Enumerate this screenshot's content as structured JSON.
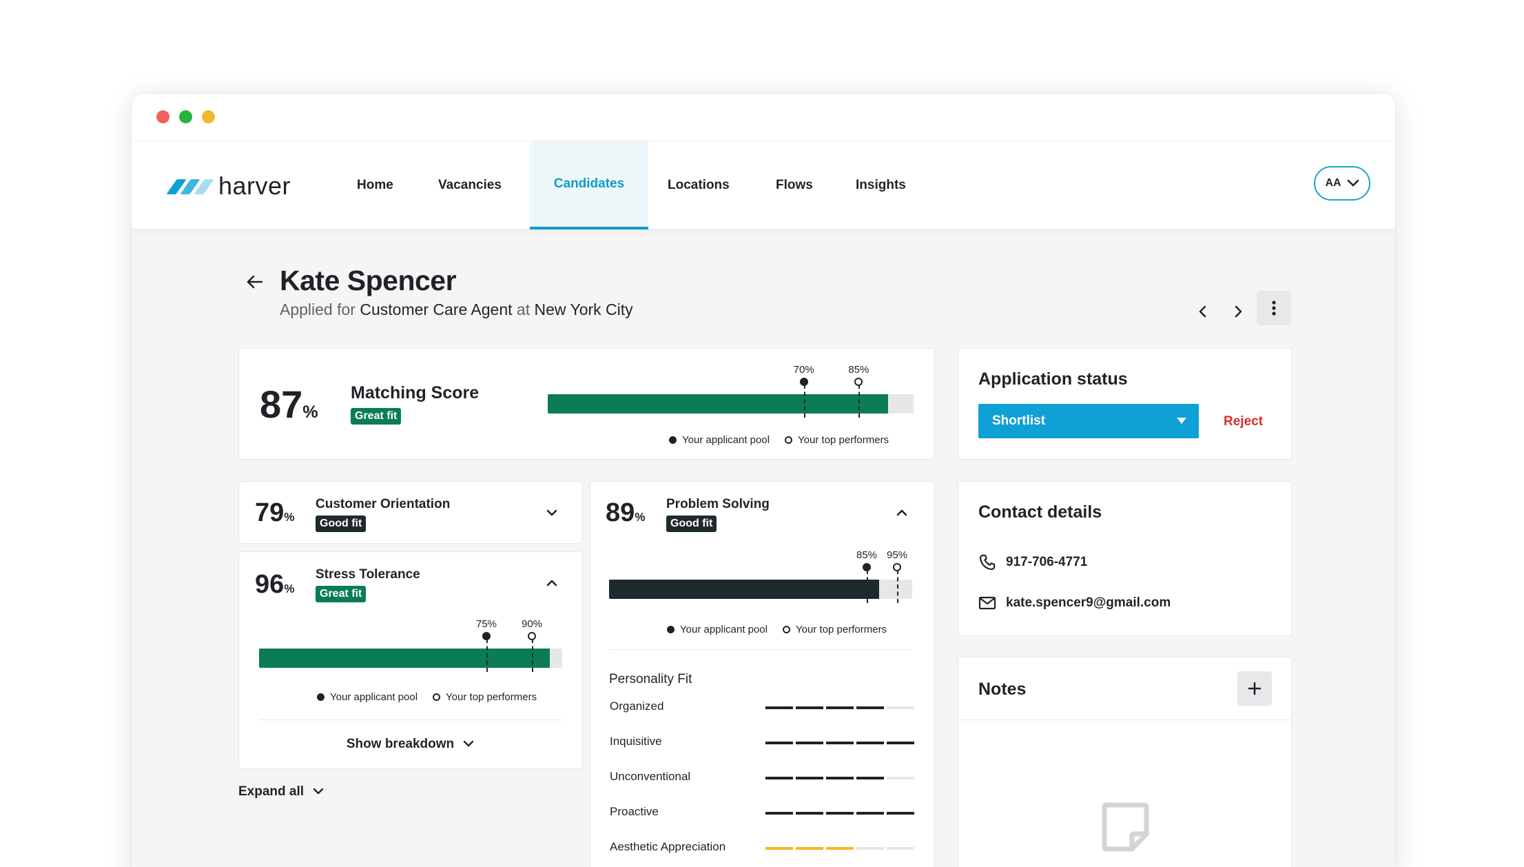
{
  "window": {
    "controls": [
      "close",
      "minimize",
      "maximize"
    ]
  },
  "nav": {
    "brand": "harver",
    "items": [
      {
        "label": "Home"
      },
      {
        "label": "Vacancies"
      },
      {
        "label": "Candidates",
        "active": true
      },
      {
        "label": "Locations"
      },
      {
        "label": "Flows"
      },
      {
        "label": "Insights"
      }
    ],
    "user_initials": "AA"
  },
  "candidate": {
    "name": "Kate Spencer",
    "applied_prefix": "Applied for",
    "role": "Customer Care Agent",
    "at_word": "at",
    "location": "New York City"
  },
  "matching": {
    "score": "87",
    "pct_sign": "%",
    "title": "Matching Score",
    "badge": "Great fit",
    "pool_pct": "70%",
    "top_pct": "85%",
    "pool_value": 70,
    "top_value": 85,
    "fill_value": 93,
    "legend_pool": "Your applicant pool",
    "legend_top": "Your top performers"
  },
  "competencies": {
    "customer_orientation": {
      "score": "79",
      "title": "Customer Orientation",
      "badge": "Good fit"
    },
    "stress_tolerance": {
      "score": "96",
      "title": "Stress Tolerance",
      "badge": "Great fit",
      "pool_pct": "75%",
      "top_pct": "90%",
      "pool_value": 75,
      "top_value": 90,
      "fill_value": 96,
      "legend_pool": "Your applicant pool",
      "legend_top": "Your top performers",
      "show_breakdown": "Show breakdown"
    },
    "problem_solving": {
      "score": "89",
      "title": "Problem Solving",
      "badge": "Good fit",
      "pool_pct": "85%",
      "top_pct": "95%",
      "pool_value": 85,
      "top_value": 95,
      "fill_value": 89,
      "legend_pool": "Your applicant pool",
      "legend_top": "Your top performers"
    },
    "expand_all": "Expand all"
  },
  "personality": {
    "title": "Personality Fit",
    "traits": [
      {
        "label": "Organized",
        "filled": 4,
        "color": "#1f2328"
      },
      {
        "label": "Inquisitive",
        "filled": 5,
        "color": "#1f2328"
      },
      {
        "label": "Unconventional",
        "filled": 4,
        "color": "#1f2328"
      },
      {
        "label": "Proactive",
        "filled": 5,
        "color": "#1f2328"
      },
      {
        "label": "Aesthetic Appreciation",
        "filled": 3,
        "color": "#f4b829"
      }
    ]
  },
  "status": {
    "title": "Application status",
    "selected": "Shortlist",
    "reject": "Reject"
  },
  "contact": {
    "title": "Contact details",
    "phone": "917-706-4771",
    "email": "kate.spencer9@gmail.com"
  },
  "notes": {
    "title": "Notes"
  },
  "colors": {
    "brand_blue": "#0fa1d6",
    "fit_green": "#0a7c56",
    "dark_bar": "#1f2a2e",
    "reject_red": "#e02b2b"
  }
}
